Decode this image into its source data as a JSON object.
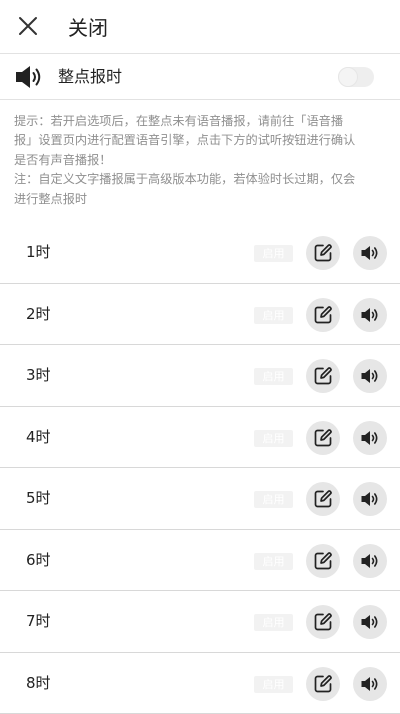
{
  "header": {
    "title": "关闭",
    "close_icon": "close-icon"
  },
  "toggle": {
    "label": "整点报时",
    "on": false,
    "icon": "speaker-icon"
  },
  "notes": {
    "line1": "提示：若开启选项后，在整点未有语音播报，请前往「语音播",
    "line2": "报」设置页内进行配置语音引擎，点击下方的试听按钮进行确认",
    "line3": "是否有声音播报！",
    "line4": "注：自定义文字播报属于高级版本功能，若体验时长过期，仅会",
    "line5": "进行整点报时"
  },
  "hours": [
    {
      "label": "1时",
      "enable_label": "启用"
    },
    {
      "label": "2时",
      "enable_label": "启用"
    },
    {
      "label": "3时",
      "enable_label": "启用"
    },
    {
      "label": "4时",
      "enable_label": "启用"
    },
    {
      "label": "5时",
      "enable_label": "启用"
    },
    {
      "label": "6时",
      "enable_label": "启用"
    },
    {
      "label": "7时",
      "enable_label": "启用"
    },
    {
      "label": "8时",
      "enable_label": "启用"
    }
  ],
  "colors": {
    "divider": "#d8d8d8",
    "button_bg": "#e6e6e6",
    "note_text": "#8f8f8f"
  }
}
